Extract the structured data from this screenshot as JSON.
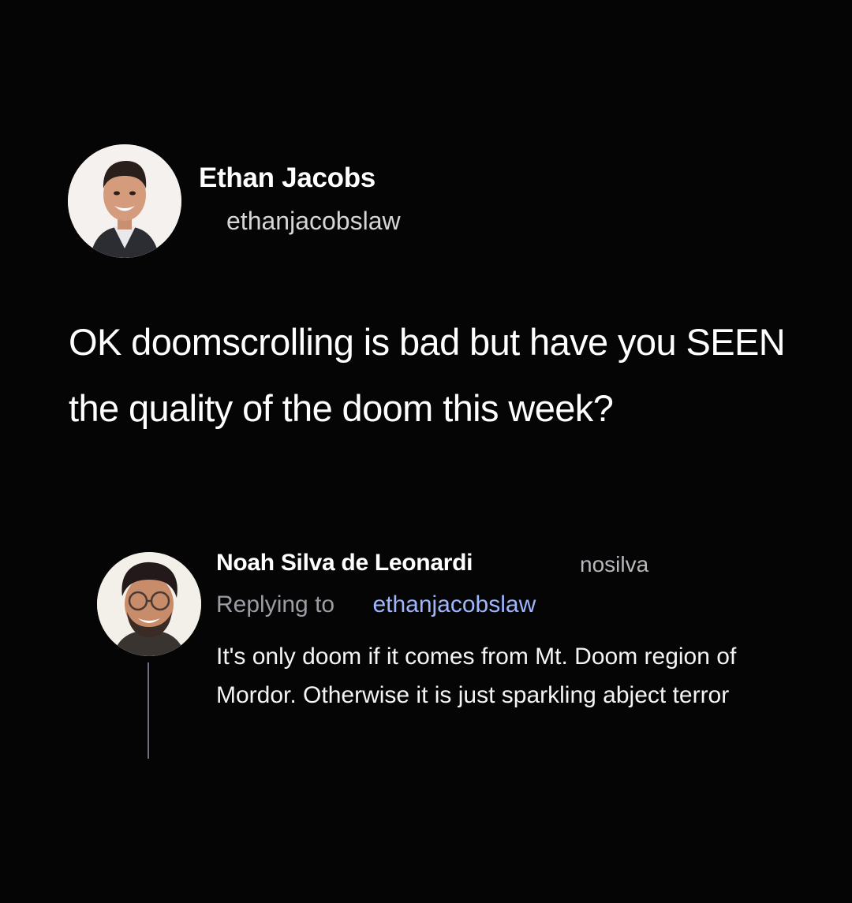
{
  "original_tweet": {
    "author_name": "Ethan Jacobs",
    "author_handle": "ethanjacobslaw",
    "text": "OK doomscrolling is bad but have you SEEN the quality of the doom this week?"
  },
  "reply": {
    "author_name": "Noah Silva de Leonardi",
    "author_handle": "nosilva",
    "replying_label": "Replying to",
    "replying_handle": "ethanjacobslaw",
    "text": "It's only doom if it comes from Mt. Doom region of Mordor. Otherwise it is just sparkling abject terror"
  },
  "colors": {
    "background": "#050506",
    "text": "#ffffff",
    "muted": "#9c9ca3",
    "link": "#9fb6ff"
  },
  "icons": {
    "author_avatar": "profile-photo",
    "reply_avatar": "profile-photo"
  }
}
